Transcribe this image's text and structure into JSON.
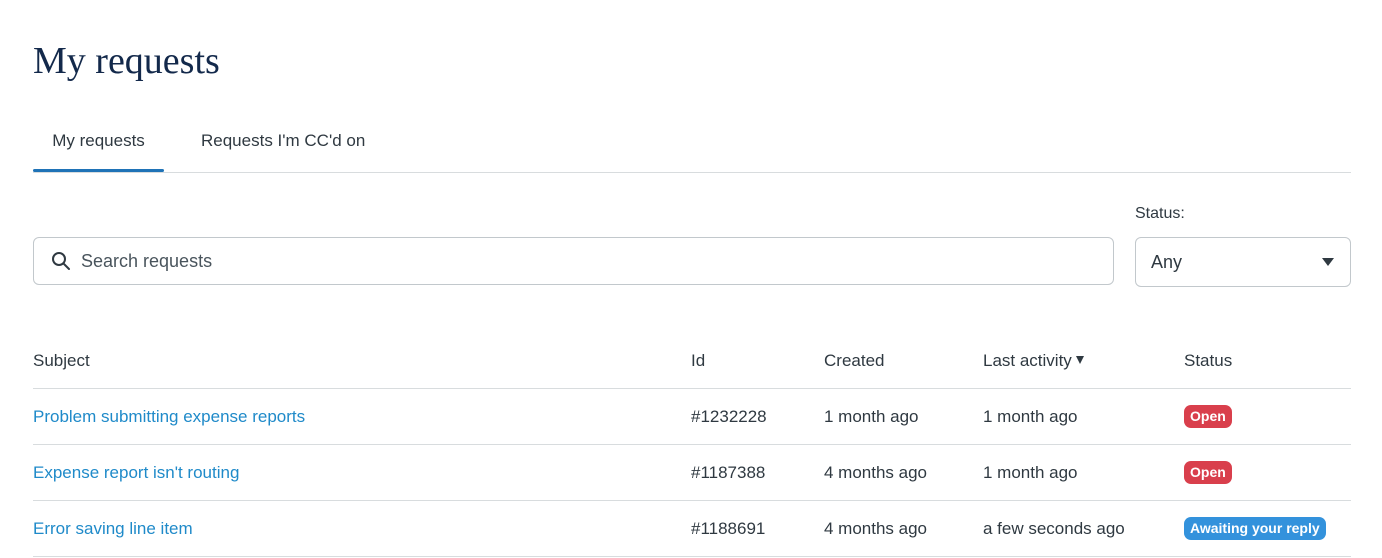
{
  "page": {
    "title": "My requests"
  },
  "tabs": [
    {
      "label": "My requests",
      "active": true
    },
    {
      "label": "Requests I'm CC'd on",
      "active": false
    }
  ],
  "filters": {
    "search_placeholder": "Search requests",
    "search_value": "",
    "status_label": "Status:",
    "status_value": "Any"
  },
  "table": {
    "headers": {
      "subject": "Subject",
      "id": "Id",
      "created": "Created",
      "last_activity": "Last activity",
      "status": "Status"
    },
    "sort": {
      "column": "last_activity",
      "direction": "descending"
    },
    "rows": [
      {
        "subject": "Problem submitting expense reports",
        "id": "#1232228",
        "created": "1 month ago",
        "last_activity": "1 month ago",
        "status": "Open",
        "status_color": "#d93f4c"
      },
      {
        "subject": "Expense report isn't routing",
        "id": "#1187388",
        "created": "4 months ago",
        "last_activity": "1 month ago",
        "status": "Open",
        "status_color": "#d93f4c"
      },
      {
        "subject": "Error saving line item",
        "id": "#1188691",
        "created": "4 months ago",
        "last_activity": "a few seconds ago",
        "status": "Awaiting your reply",
        "status_color": "#3392dc"
      }
    ]
  },
  "colors": {
    "title": "#13294b",
    "accent": "#1f73b7",
    "link": "#1f8ac9",
    "status_open": "#d93f4c",
    "status_awaiting": "#3392dc",
    "border": "#d8dcde"
  },
  "icons": {
    "search": "search-icon",
    "status_dropdown": "chevron-down-icon",
    "sort_indicator": "sort-descending-icon"
  }
}
